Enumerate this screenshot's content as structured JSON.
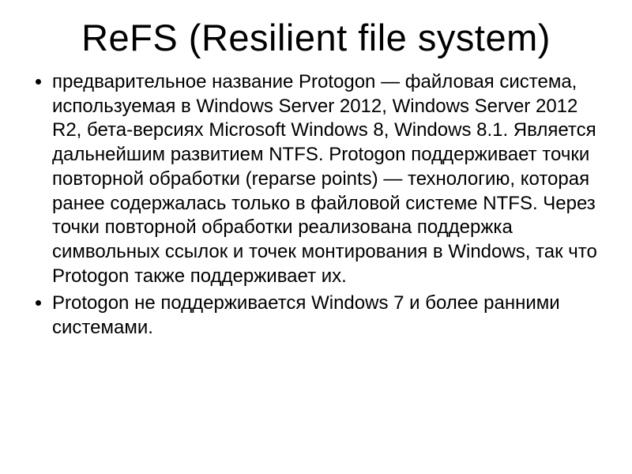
{
  "slide": {
    "title": "ReFS (Resilient file system)",
    "bullets": [
      "предварительное название Protogon — файловая система, используемая в Windows Server 2012, Windows Server 2012 R2, бета-версиях Microsoft Windows 8, Windows 8.1. Является дальнейшим развитием NTFS. Protogon поддерживает точки повторной обработки (reparse points) — технологию, которая ранее содержалась только в файловой системе NTFS. Через точки повторной обработки реализована поддержка символьных ссылок и точек монтирования в Windows, так что Protogon также поддерживает их.",
      "Protogon не поддерживается Windows 7 и более ранними системами."
    ]
  }
}
